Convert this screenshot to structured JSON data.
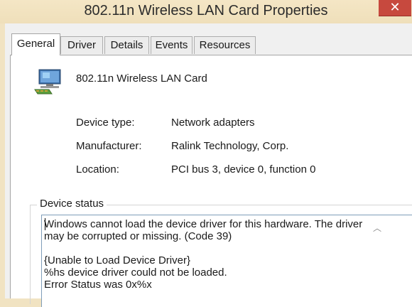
{
  "window": {
    "title": "802.11n Wireless LAN Card Properties",
    "close_label": "✕"
  },
  "tabs": [
    {
      "label": "General",
      "active": true
    },
    {
      "label": "Driver",
      "active": false
    },
    {
      "label": "Details",
      "active": false
    },
    {
      "label": "Events",
      "active": false
    },
    {
      "label": "Resources",
      "active": false
    }
  ],
  "device": {
    "icon": "network-adapter-icon",
    "name": "802.11n Wireless LAN Card",
    "properties": [
      {
        "label": "Device type:",
        "value": "Network adapters"
      },
      {
        "label": "Manufacturer:",
        "value": "Ralink Technology, Corp."
      },
      {
        "label": "Location:",
        "value": "PCI bus 3, device 0, function 0"
      }
    ]
  },
  "device_status": {
    "title": "Device status",
    "text": "Windows cannot load the device driver for this hardware. The driver may be corrupted or missing. (Code 39)\n\n{Unable to Load Device Driver}\n%hs device driver could not be loaded.\nError Status was 0x%x"
  },
  "colors": {
    "title_bar": "#f1e3c2",
    "close_button": "#c7493e"
  }
}
